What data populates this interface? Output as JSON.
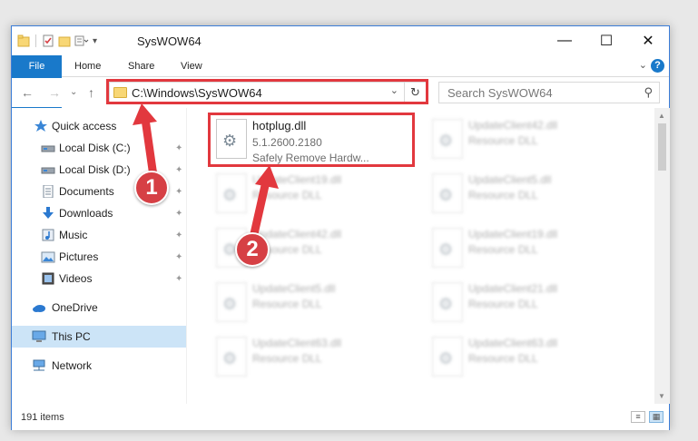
{
  "window": {
    "title": "SysWOW64",
    "minimize_glyph": "—",
    "maximize_glyph": "☐",
    "close_glyph": "✕"
  },
  "ribbon": {
    "tabs": [
      "File",
      "Home",
      "Share",
      "View"
    ],
    "expand_glyph": "⌄",
    "help_glyph": "?"
  },
  "navigation": {
    "back_glyph": "←",
    "forward_glyph": "→",
    "recent_glyph": "⌄",
    "up_glyph": "↑",
    "address_path": "C:\\Windows\\SysWOW64",
    "address_dropdown_glyph": "⌄",
    "refresh_glyph": "↻",
    "search_placeholder": "Search SysWOW64",
    "search_glyph": "⚲"
  },
  "sidebar": {
    "items": [
      {
        "label": "Quick access",
        "icon": "star-icon",
        "pinned": false
      },
      {
        "label": "Local Disk (C:)",
        "icon": "drive-icon",
        "pinned": true
      },
      {
        "label": "Local Disk (D:)",
        "icon": "drive-icon",
        "pinned": true
      },
      {
        "label": "Documents",
        "icon": "documents-icon",
        "pinned": true
      },
      {
        "label": "Downloads",
        "icon": "download-icon",
        "pinned": true
      },
      {
        "label": "Music",
        "icon": "music-icon",
        "pinned": true
      },
      {
        "label": "Pictures",
        "icon": "pictures-icon",
        "pinned": true
      },
      {
        "label": "Videos",
        "icon": "videos-icon",
        "pinned": true
      },
      {
        "label": "OneDrive",
        "icon": "cloud-icon",
        "pinned": false
      },
      {
        "label": "This PC",
        "icon": "computer-icon",
        "pinned": false,
        "selected": true
      },
      {
        "label": "Network",
        "icon": "network-icon",
        "pinned": false
      }
    ],
    "pin_glyph": "📌"
  },
  "files": {
    "highlighted": {
      "name": "hotplug.dll",
      "version": "5.1.2600.2180",
      "description": "Safely Remove Hardw..."
    },
    "blurred": [
      {
        "name": "UpdateClient42.dll",
        "description": "Resource DLL"
      },
      {
        "name": "UpdateClient19.dll",
        "description": "Resource DLL"
      },
      {
        "name": "UpdateClient5.dll",
        "description": "Resource DLL"
      },
      {
        "name": "UpdateClient42.dll",
        "description": "Resource DLL"
      },
      {
        "name": "UpdateClient19.dll",
        "description": "Resource DLL"
      },
      {
        "name": "UpdateClient5.dll",
        "description": "Resource DLL"
      },
      {
        "name": "UpdateClient21.dll",
        "description": "Resource DLL"
      },
      {
        "name": "UpdateClient63.dll",
        "description": "Resource DLL"
      },
      {
        "name": "UpdateClient63.dll",
        "description": "Resource DLL"
      }
    ]
  },
  "status": {
    "item_count": "191 items"
  },
  "annotations": {
    "callout_1": "1",
    "callout_2": "2",
    "color": "#e2383e"
  }
}
